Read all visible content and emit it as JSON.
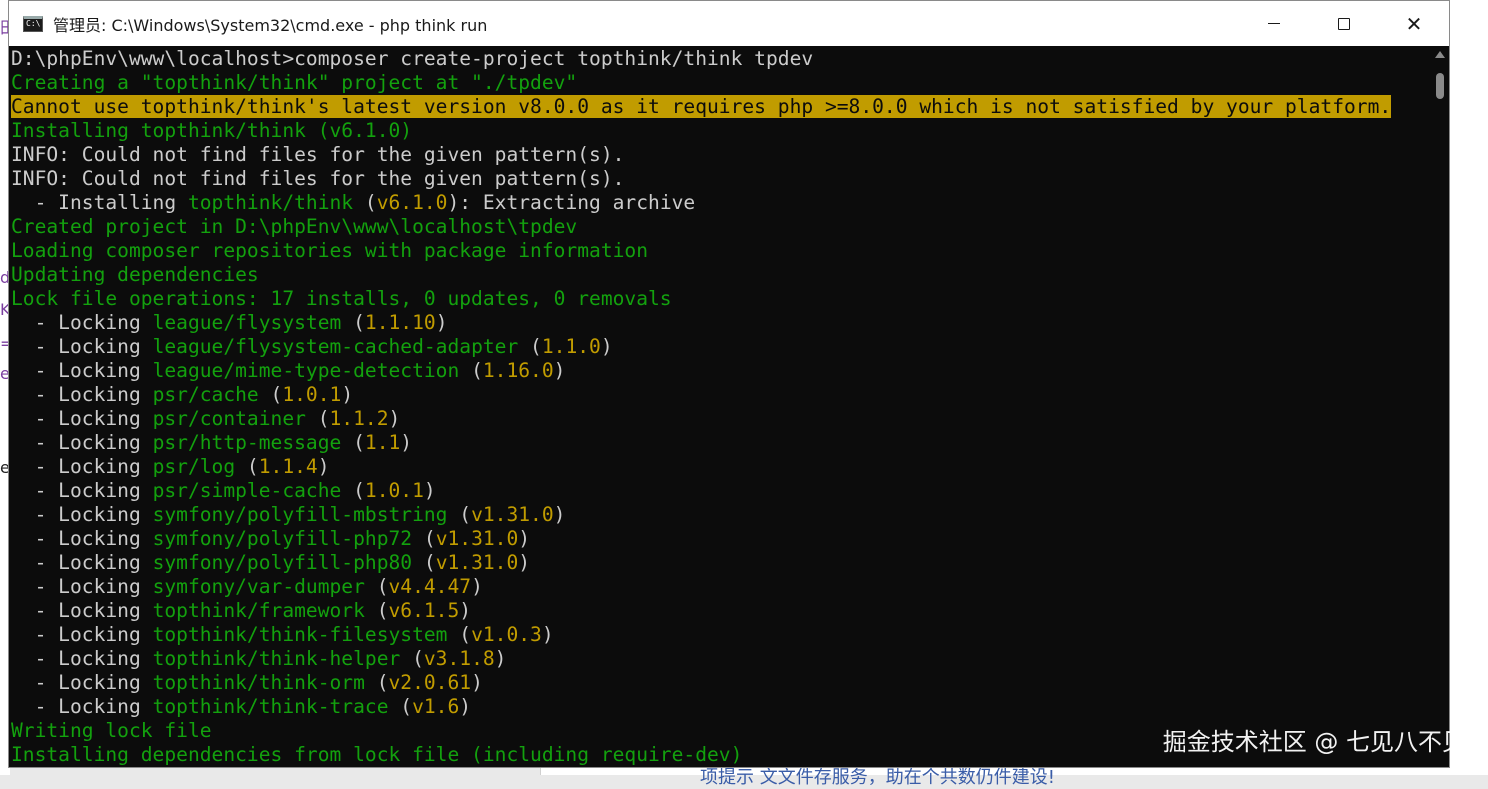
{
  "window": {
    "title": "管理员: C:\\Windows\\System32\\cmd.exe - php  think run"
  },
  "console": {
    "lines": [
      [
        {
          "t": "D:\\phpEnv\\www\\localhost>composer create-project topthink/think tpdev",
          "c": "w"
        }
      ],
      [
        {
          "t": "Creating a \"topthink/think\" project at \"./tpdev\"",
          "c": "g"
        }
      ],
      [
        {
          "t": "Cannot use topthink/think's latest version v8.0.0 as it requires php >=8.0.0 which is not satisfied by your platform.",
          "c": "warn"
        }
      ],
      [
        {
          "t": "Installing topthink/think (v6.1.0)",
          "c": "g"
        }
      ],
      [
        {
          "t": "INFO: Could not find files for the given pattern(s).",
          "c": "w"
        }
      ],
      [
        {
          "t": "INFO: Could not find files for the given pattern(s).",
          "c": "w"
        }
      ],
      [
        {
          "t": "  - Installing ",
          "c": "w"
        },
        {
          "t": "topthink/think",
          "c": "g"
        },
        {
          "t": " (",
          "c": "w"
        },
        {
          "t": "v6.1.0",
          "c": "y"
        },
        {
          "t": "): Extracting archive",
          "c": "w"
        }
      ],
      [
        {
          "t": "Created project in D:\\phpEnv\\www\\localhost\\tpdev",
          "c": "g"
        }
      ],
      [
        {
          "t": "Loading composer repositories with package information",
          "c": "g"
        }
      ],
      [
        {
          "t": "Updating dependencies",
          "c": "g"
        }
      ],
      [
        {
          "t": "Lock file operations: 17 installs, 0 updates, 0 removals",
          "c": "g"
        }
      ],
      [
        {
          "t": "  - Locking ",
          "c": "w"
        },
        {
          "t": "league/flysystem",
          "c": "g"
        },
        {
          "t": " (",
          "c": "w"
        },
        {
          "t": "1.1.10",
          "c": "y"
        },
        {
          "t": ")",
          "c": "w"
        }
      ],
      [
        {
          "t": "  - Locking ",
          "c": "w"
        },
        {
          "t": "league/flysystem-cached-adapter",
          "c": "g"
        },
        {
          "t": " (",
          "c": "w"
        },
        {
          "t": "1.1.0",
          "c": "y"
        },
        {
          "t": ")",
          "c": "w"
        }
      ],
      [
        {
          "t": "  - Locking ",
          "c": "w"
        },
        {
          "t": "league/mime-type-detection",
          "c": "g"
        },
        {
          "t": " (",
          "c": "w"
        },
        {
          "t": "1.16.0",
          "c": "y"
        },
        {
          "t": ")",
          "c": "w"
        }
      ],
      [
        {
          "t": "  - Locking ",
          "c": "w"
        },
        {
          "t": "psr/cache",
          "c": "g"
        },
        {
          "t": " (",
          "c": "w"
        },
        {
          "t": "1.0.1",
          "c": "y"
        },
        {
          "t": ")",
          "c": "w"
        }
      ],
      [
        {
          "t": "  - Locking ",
          "c": "w"
        },
        {
          "t": "psr/container",
          "c": "g"
        },
        {
          "t": " (",
          "c": "w"
        },
        {
          "t": "1.1.2",
          "c": "y"
        },
        {
          "t": ")",
          "c": "w"
        }
      ],
      [
        {
          "t": "  - Locking ",
          "c": "w"
        },
        {
          "t": "psr/http-message",
          "c": "g"
        },
        {
          "t": " (",
          "c": "w"
        },
        {
          "t": "1.1",
          "c": "y"
        },
        {
          "t": ")",
          "c": "w"
        }
      ],
      [
        {
          "t": "  - Locking ",
          "c": "w"
        },
        {
          "t": "psr/log",
          "c": "g"
        },
        {
          "t": " (",
          "c": "w"
        },
        {
          "t": "1.1.4",
          "c": "y"
        },
        {
          "t": ")",
          "c": "w"
        }
      ],
      [
        {
          "t": "  - Locking ",
          "c": "w"
        },
        {
          "t": "psr/simple-cache",
          "c": "g"
        },
        {
          "t": " (",
          "c": "w"
        },
        {
          "t": "1.0.1",
          "c": "y"
        },
        {
          "t": ")",
          "c": "w"
        }
      ],
      [
        {
          "t": "  - Locking ",
          "c": "w"
        },
        {
          "t": "symfony/polyfill-mbstring",
          "c": "g"
        },
        {
          "t": " (",
          "c": "w"
        },
        {
          "t": "v1.31.0",
          "c": "y"
        },
        {
          "t": ")",
          "c": "w"
        }
      ],
      [
        {
          "t": "  - Locking ",
          "c": "w"
        },
        {
          "t": "symfony/polyfill-php72",
          "c": "g"
        },
        {
          "t": " (",
          "c": "w"
        },
        {
          "t": "v1.31.0",
          "c": "y"
        },
        {
          "t": ")",
          "c": "w"
        }
      ],
      [
        {
          "t": "  - Locking ",
          "c": "w"
        },
        {
          "t": "symfony/polyfill-php80",
          "c": "g"
        },
        {
          "t": " (",
          "c": "w"
        },
        {
          "t": "v1.31.0",
          "c": "y"
        },
        {
          "t": ")",
          "c": "w"
        }
      ],
      [
        {
          "t": "  - Locking ",
          "c": "w"
        },
        {
          "t": "symfony/var-dumper",
          "c": "g"
        },
        {
          "t": " (",
          "c": "w"
        },
        {
          "t": "v4.4.47",
          "c": "y"
        },
        {
          "t": ")",
          "c": "w"
        }
      ],
      [
        {
          "t": "  - Locking ",
          "c": "w"
        },
        {
          "t": "topthink/framework",
          "c": "g"
        },
        {
          "t": " (",
          "c": "w"
        },
        {
          "t": "v6.1.5",
          "c": "y"
        },
        {
          "t": ")",
          "c": "w"
        }
      ],
      [
        {
          "t": "  - Locking ",
          "c": "w"
        },
        {
          "t": "topthink/think-filesystem",
          "c": "g"
        },
        {
          "t": " (",
          "c": "w"
        },
        {
          "t": "v1.0.3",
          "c": "y"
        },
        {
          "t": ")",
          "c": "w"
        }
      ],
      [
        {
          "t": "  - Locking ",
          "c": "w"
        },
        {
          "t": "topthink/think-helper",
          "c": "g"
        },
        {
          "t": " (",
          "c": "w"
        },
        {
          "t": "v3.1.8",
          "c": "y"
        },
        {
          "t": ")",
          "c": "w"
        }
      ],
      [
        {
          "t": "  - Locking ",
          "c": "w"
        },
        {
          "t": "topthink/think-orm",
          "c": "g"
        },
        {
          "t": " (",
          "c": "w"
        },
        {
          "t": "v2.0.61",
          "c": "y"
        },
        {
          "t": ")",
          "c": "w"
        }
      ],
      [
        {
          "t": "  - Locking ",
          "c": "w"
        },
        {
          "t": "topthink/think-trace",
          "c": "g"
        },
        {
          "t": " (",
          "c": "w"
        },
        {
          "t": "v1.6",
          "c": "y"
        },
        {
          "t": ")",
          "c": "w"
        }
      ],
      [
        {
          "t": "Writing lock file",
          "c": "g"
        }
      ],
      [
        {
          "t": "Installing dependencies from lock file (including require-dev)",
          "c": "g"
        }
      ]
    ]
  },
  "watermark": "掘金技术社区 @ 七见八不见",
  "background": {
    "left_glyphs": [
      "田",
      "d",
      "K",
      "=",
      "e",
      "e"
    ],
    "bottom_text": "项提示   文文件存服务，助在个共数仍件建设!"
  },
  "icons": [
    "cmd-app-icon",
    "minimize-icon",
    "maximize-icon",
    "close-icon",
    "scroll-up-icon"
  ]
}
